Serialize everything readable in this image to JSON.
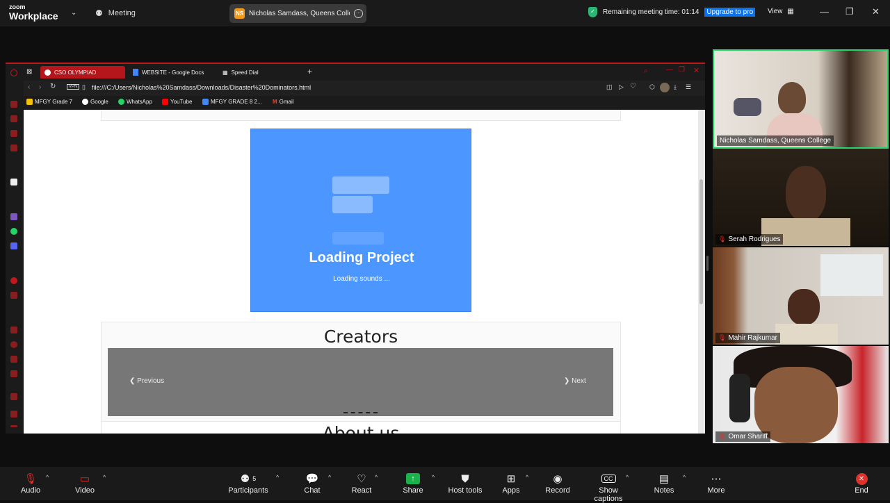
{
  "zoom": {
    "logo_line1": "zoom",
    "logo_line2": "Workplace",
    "meeting_label": "Meeting",
    "active_speaker": {
      "initials": "NS",
      "name": "Nicholas Samdass, Queens College"
    },
    "remaining_time": "Remaining meeting time: 01:14",
    "upgrade_label": "Upgrade to pro",
    "view_label": "View"
  },
  "browser": {
    "tabs": [
      {
        "label": "CSO OLYMPIAD",
        "active": true
      },
      {
        "label": "WEBSITE - Google Docs",
        "active": false
      },
      {
        "label": "Speed Dial",
        "active": false
      }
    ],
    "vpn_label": "VPN",
    "url": "file:///C:/Users/Nicholas%20Samdass/Downloads/Disaster%20Dominators.html",
    "bookmarks": [
      "MFGY Grade 7",
      "Google",
      "WhatsApp",
      "YouTube",
      "MFGY GRADE 8 2...",
      "Gmail"
    ]
  },
  "webpage": {
    "loading_title": "Loading Project",
    "loading_sub": "Loading sounds ...",
    "creators_title": "Creators",
    "prev_label": "Previous",
    "next_label": "Next",
    "about_title": "About us"
  },
  "participants": [
    {
      "name": "Nicholas Samdass, Queens College",
      "muted": false,
      "active": true
    },
    {
      "name": "Serah Rodrigues",
      "muted": true,
      "active": false
    },
    {
      "name": "Mahir Rajkumar",
      "muted": true,
      "active": false
    },
    {
      "name": "Omar Shariff",
      "muted": true,
      "active": false
    }
  ],
  "toolbar": {
    "audio": "Audio",
    "video": "Video",
    "participants": "Participants",
    "participants_count": "5",
    "chat": "Chat",
    "react": "React",
    "share": "Share",
    "host_tools": "Host tools",
    "apps": "Apps",
    "record": "Record",
    "captions": "Show captions",
    "notes": "Notes",
    "more": "More",
    "end": "End"
  },
  "colors": {
    "upgrade_blue": "#0e72ed",
    "scratch_blue": "#4c97ff",
    "browser_red": "#b5161b",
    "active_speaker_border": "#2bd46b",
    "share_green": "#1bb24b",
    "end_red": "#e0322c"
  }
}
